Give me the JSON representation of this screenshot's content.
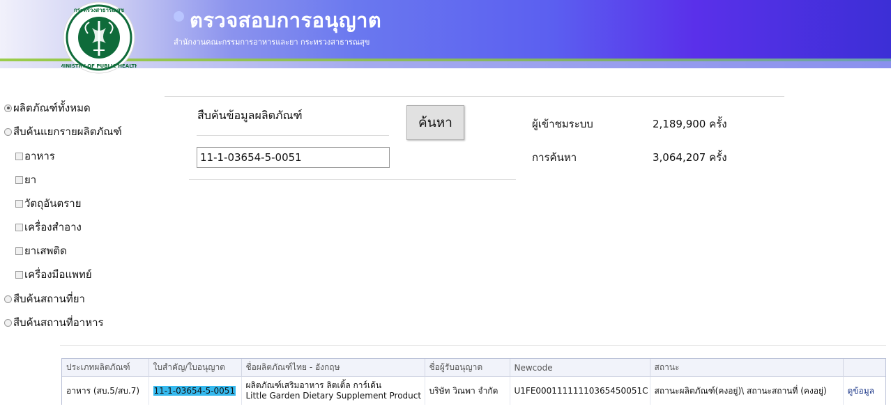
{
  "header": {
    "title": "ตรวจสอบการอนุญาต",
    "subtitle": "สำนักงานคณะกรรมการอาหารและยา กระทรวงสาธารณสุข",
    "logo_text": "กระทรวงสาธารณสุข MINISTRY OF PUBLIC HEALTH"
  },
  "sidebar": {
    "items": [
      {
        "label": "ผลิตภัณฑ์ทั้งหมด",
        "type": "radio",
        "checked": true
      },
      {
        "label": "สืบค้นแยกรายผลิตภัณฑ์",
        "type": "radio",
        "checked": false
      },
      {
        "label": "อาหาร",
        "type": "checkbox",
        "checked": false
      },
      {
        "label": "ยา",
        "type": "checkbox",
        "checked": false
      },
      {
        "label": "วัตถุอันตราย",
        "type": "checkbox",
        "checked": false
      },
      {
        "label": "เครื่องสำอาง",
        "type": "checkbox",
        "checked": false
      },
      {
        "label": "ยาเสพติด",
        "type": "checkbox",
        "checked": false
      },
      {
        "label": "เครื่องมือแพทย์",
        "type": "checkbox",
        "checked": false
      },
      {
        "label": "สืบค้นสถานที่ยา",
        "type": "radio",
        "checked": false
      },
      {
        "label": "สืบค้นสถานที่อาหาร",
        "type": "radio",
        "checked": false
      }
    ]
  },
  "search": {
    "title": "สืบค้นข้อมูลผลิตภัณฑ์",
    "value": "11-1-03654-5-0051",
    "button_label": "ค้นหา"
  },
  "stats": {
    "visitors_label": "ผู้เข้าชมระบบ",
    "visitors_value": "2,189,900 ครั้ง",
    "searches_label": "การค้นหา",
    "searches_value": "3,064,207 ครั้ง"
  },
  "results": {
    "columns": [
      "ประเภทผลิตภัณฑ์",
      "ใบสำคัญ/ใบอนุญาต",
      "ชื่อผลิตภัณฑ์ไทย - อังกฤษ",
      "ชื่อผู้รับอนุญาต",
      "Newcode",
      "สถานะ",
      ""
    ],
    "rows": [
      {
        "type": "อาหาร (สบ.5/สบ.7)",
        "license": "11-1-03654-5-0051",
        "name_th": "ผลิตภัณฑ์เสริมอาหาร ลิตเติ้ล การ์เด้น",
        "name_en": "Little Garden Dietary Supplement Product",
        "licensee": "บริษัท วิณพา จำกัด",
        "newcode": "U1FE00011111110365450051C",
        "status": "สถานะผลิตภัณฑ์(คงอยู่)\\ สถานะสถานที่ (คงอยู่)",
        "action": "ดูข้อมูล"
      }
    ]
  },
  "colors": {
    "header_gradient_start": "#f1f1fb",
    "header_gradient_end": "#3c2fd6",
    "header_stripe": "#9acc4a",
    "highlight": "#35b9ee",
    "logo_green": "#0f6b3a"
  }
}
